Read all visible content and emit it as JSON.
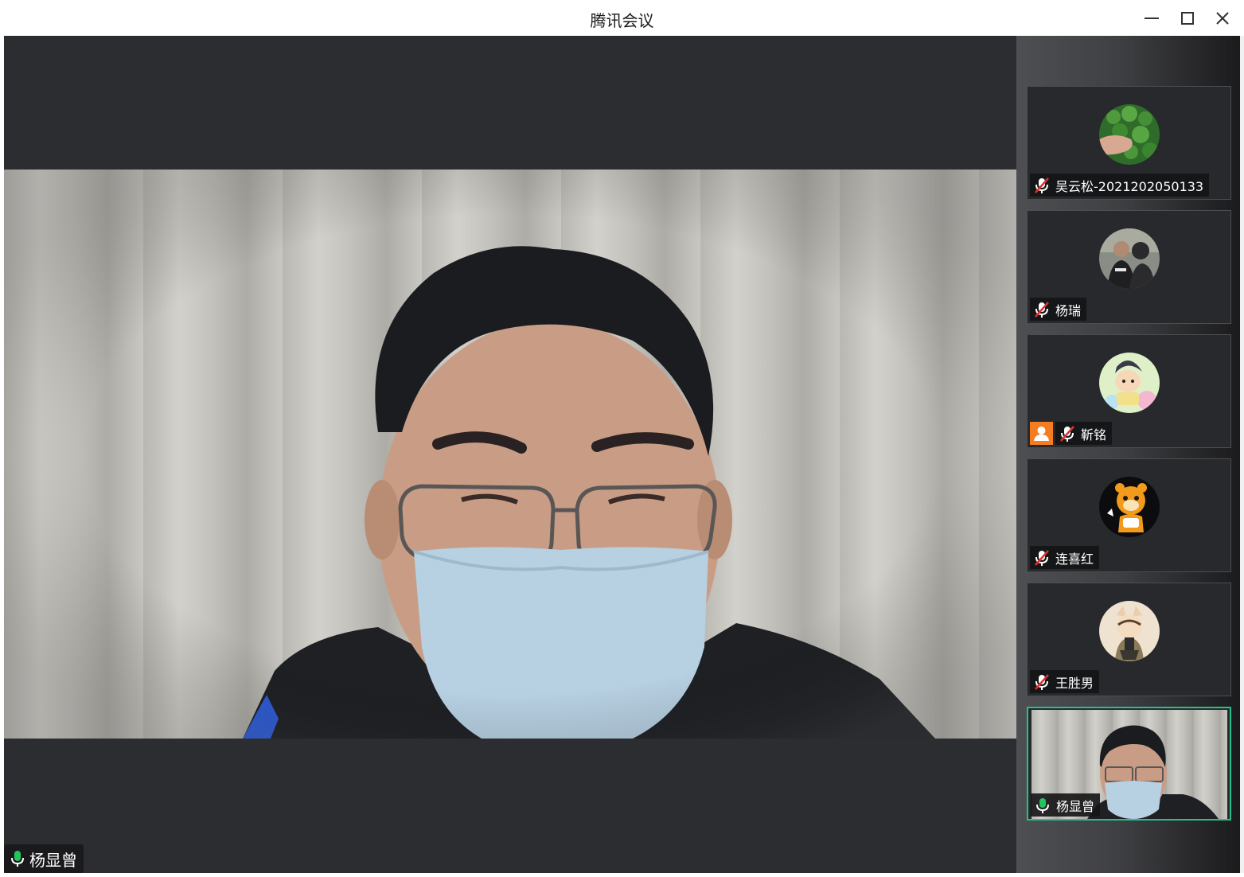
{
  "window": {
    "title": "腾讯会议",
    "controls": [
      "minimize",
      "maximize",
      "close"
    ]
  },
  "main_speaker": {
    "name": "杨显曾",
    "mic": "on",
    "icon": "mic-on-icon"
  },
  "participants": [
    {
      "name": "吴云松-2021202050133",
      "mic": "muted",
      "avatar": "clover-leaf-avatar"
    },
    {
      "name": "杨瑞",
      "mic": "muted",
      "avatar": "photo-avatar"
    },
    {
      "name": "靳铭",
      "mic": "muted",
      "avatar": "cartoon-avatar",
      "host": true
    },
    {
      "name": "连喜红",
      "mic": "muted",
      "avatar": "tiger-cartoon-avatar"
    },
    {
      "name": "王胜男",
      "mic": "muted",
      "avatar": "illustrated-avatar"
    },
    {
      "name": "杨显曾",
      "mic": "on",
      "avatar": "self-video",
      "active": true
    }
  ],
  "colors": {
    "stage_bg": "#2b2d30",
    "active_border": "#23c18b",
    "mic_on": "#22c55e",
    "mute_red": "#e0302f",
    "host_badge": "#f57c1f"
  }
}
